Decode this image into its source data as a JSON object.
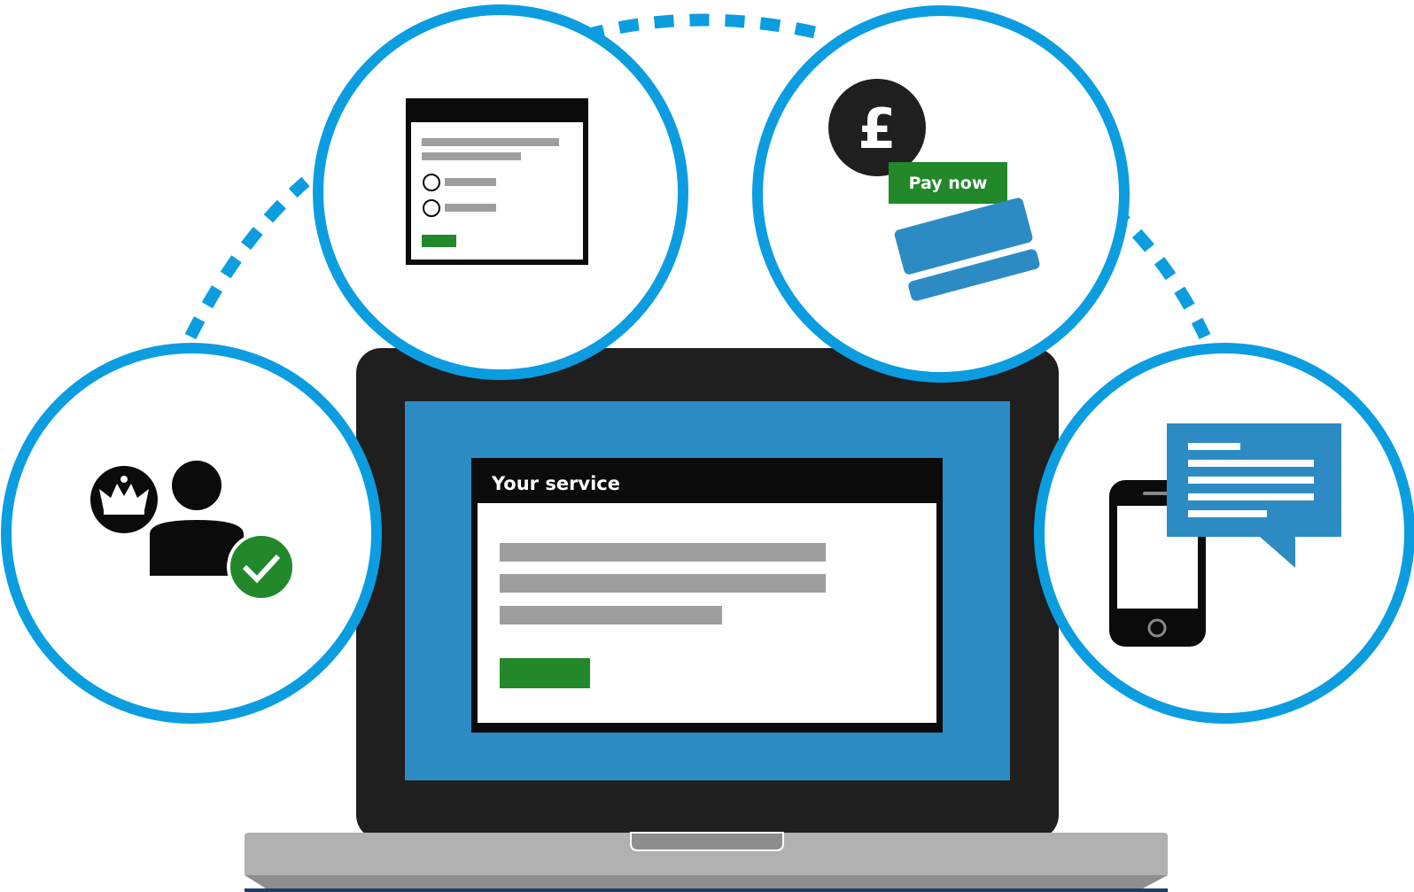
{
  "screen": {
    "window_title": "Your service"
  },
  "payment": {
    "currency_symbol": "£",
    "pay_button_label": "Pay now"
  },
  "colors": {
    "accent_blue": "#0b9de0",
    "screen_blue": "#2d8bc4",
    "button_green": "#22882a",
    "dark": "#1f1f1f",
    "placeholder_grey": "#9e9e9e",
    "laptop_base": "#b1b1b1"
  },
  "icons": {
    "identity": [
      "crown-icon",
      "person-icon",
      "check-icon"
    ],
    "form": "web-form-icon",
    "payment": [
      "pound-coin-icon",
      "credit-card-icon"
    ],
    "notify": [
      "mobile-phone-icon",
      "speech-bubble-icon"
    ]
  }
}
